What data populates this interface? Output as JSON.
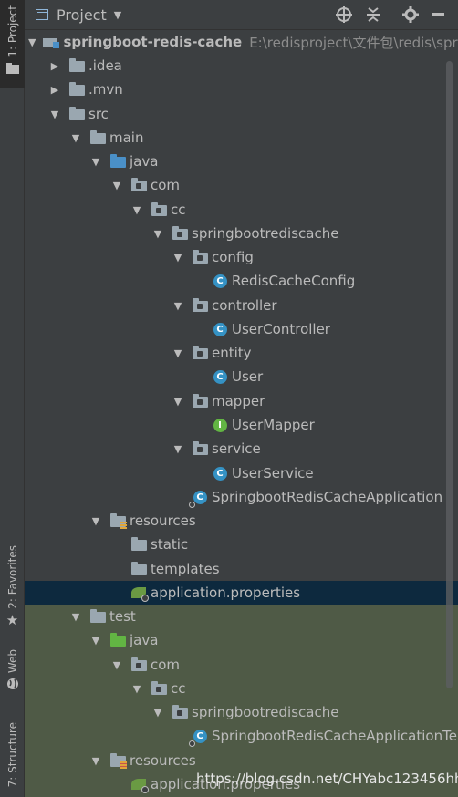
{
  "tool_strip": {
    "project_tab": "1: Project",
    "favorites_tab": "2: Favorites",
    "web_tab": "Web",
    "structure_tab": "7: Structure"
  },
  "header": {
    "title": "Project",
    "buttons": [
      "locate-icon",
      "collapse-all-icon",
      "gear-icon",
      "hide-icon"
    ]
  },
  "tree": {
    "root_name": "springboot-redis-cache",
    "root_path": "E:\\redisproject\\文件包\\redis\\spring",
    "idea": ".idea",
    "mvn": ".mvn",
    "src": "src",
    "main": "main",
    "java": "java",
    "com": "com",
    "cc": "cc",
    "pkg": "springbootrediscache",
    "config": "config",
    "redis_cache_config": "RedisCacheConfig",
    "controller": "controller",
    "user_controller": "UserController",
    "entity": "entity",
    "user": "User",
    "mapper": "mapper",
    "user_mapper": "UserMapper",
    "service": "service",
    "user_service": "UserService",
    "app_class": "SpringbootRedisCacheApplication",
    "resources": "resources",
    "static": "static",
    "templates": "templates",
    "app_properties": "application.properties",
    "test": "test",
    "test_java": "java",
    "test_com": "com",
    "test_cc": "cc",
    "test_pkg": "springbootrediscache",
    "test_class": "SpringbootRedisCacheApplicationTe",
    "test_resources": "resources",
    "test_app_properties": "application.properties"
  },
  "watermark": "https://blog.csdn.net/CHYabc123456hh",
  "colors": {
    "panel_bg": "#3c3f41",
    "selection": "#0d293e",
    "test_bg": "#4f5a46",
    "source_folder": "#4a90c8",
    "test_folder": "#62b543"
  }
}
